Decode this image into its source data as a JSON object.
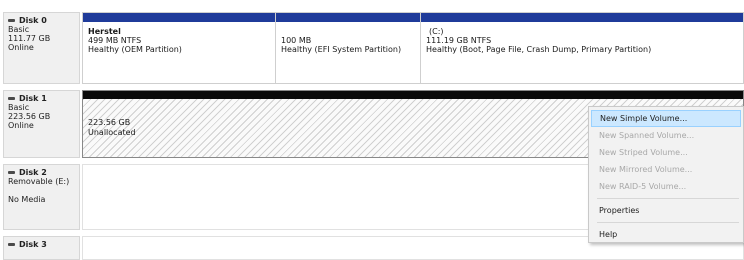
{
  "colors": {
    "primary_bar": "#1f3b9a",
    "unallocated_bar": "#0a0a0a",
    "menu_hover": "#cce8ff"
  },
  "disks": [
    {
      "name": "Disk 0",
      "lines": [
        "Basic",
        "111.77 GB",
        "Online"
      ],
      "partitions": [
        {
          "title": "Herstel",
          "size": "499 MB NTFS",
          "status": "Healthy (OEM Partition)"
        },
        {
          "title": "",
          "size": "100 MB",
          "status": "Healthy (EFI System Partition)"
        },
        {
          "title": "(C:)",
          "size": "111.19 GB NTFS",
          "status": "Healthy (Boot, Page File, Crash Dump, Primary Partition)"
        }
      ]
    },
    {
      "name": "Disk 1",
      "lines": [
        "Basic",
        "223.56 GB",
        "Online"
      ],
      "unallocated": {
        "size": "223.56 GB",
        "status": "Unallocated"
      }
    },
    {
      "name": "Disk 2",
      "lines": [
        "Removable (E:)",
        "",
        "No Media"
      ]
    },
    {
      "name": "Disk 3",
      "lines": []
    }
  ],
  "context_menu": {
    "items": [
      {
        "label": "New Simple Volume...",
        "enabled": true,
        "highlighted": true
      },
      {
        "label": "New Spanned Volume...",
        "enabled": false
      },
      {
        "label": "New Striped Volume...",
        "enabled": false
      },
      {
        "label": "New Mirrored Volume...",
        "enabled": false
      },
      {
        "label": "New RAID-5 Volume...",
        "enabled": false
      },
      {
        "label": "Properties",
        "enabled": true
      },
      {
        "label": "Help",
        "enabled": true
      }
    ]
  }
}
